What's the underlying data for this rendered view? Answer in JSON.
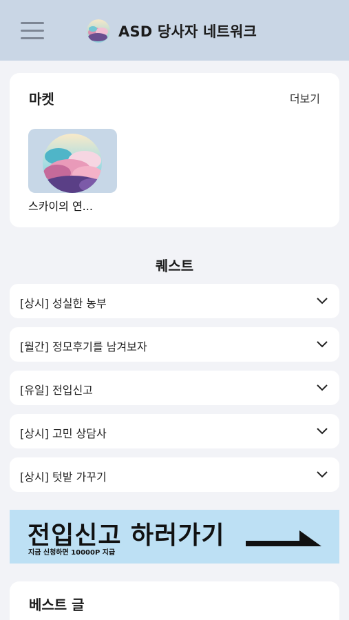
{
  "header": {
    "title": "ASD 당사자 네트워크",
    "menu_icon": "hamburger-menu-icon",
    "logo_icon": "cloud-logo-icon",
    "background": "#c9d6e5"
  },
  "market": {
    "title": "마켓",
    "more_label": "더보기",
    "products": [
      {
        "name": "스카이의 연...",
        "thumb_icon": "cloud-artwork-thumbnail"
      }
    ]
  },
  "quests": {
    "heading": "퀘스트",
    "items": [
      {
        "label": "[상시] 성실한 농부"
      },
      {
        "label": "[월간] 정모후기를 남겨보자"
      },
      {
        "label": "[유일] 전입신고"
      },
      {
        "label": "[상시] 고민 상담사"
      },
      {
        "label": "[상시] 텃밭 가꾸기"
      }
    ],
    "expand_icon": "chevron-down-icon"
  },
  "banner": {
    "title": "전입신고 하러가기",
    "subtitle": "지금 신청하면 10000P 지급",
    "arrow_icon": "arrow-right-icon",
    "background": "#bde0f4"
  },
  "best": {
    "title": "베스트 글"
  }
}
